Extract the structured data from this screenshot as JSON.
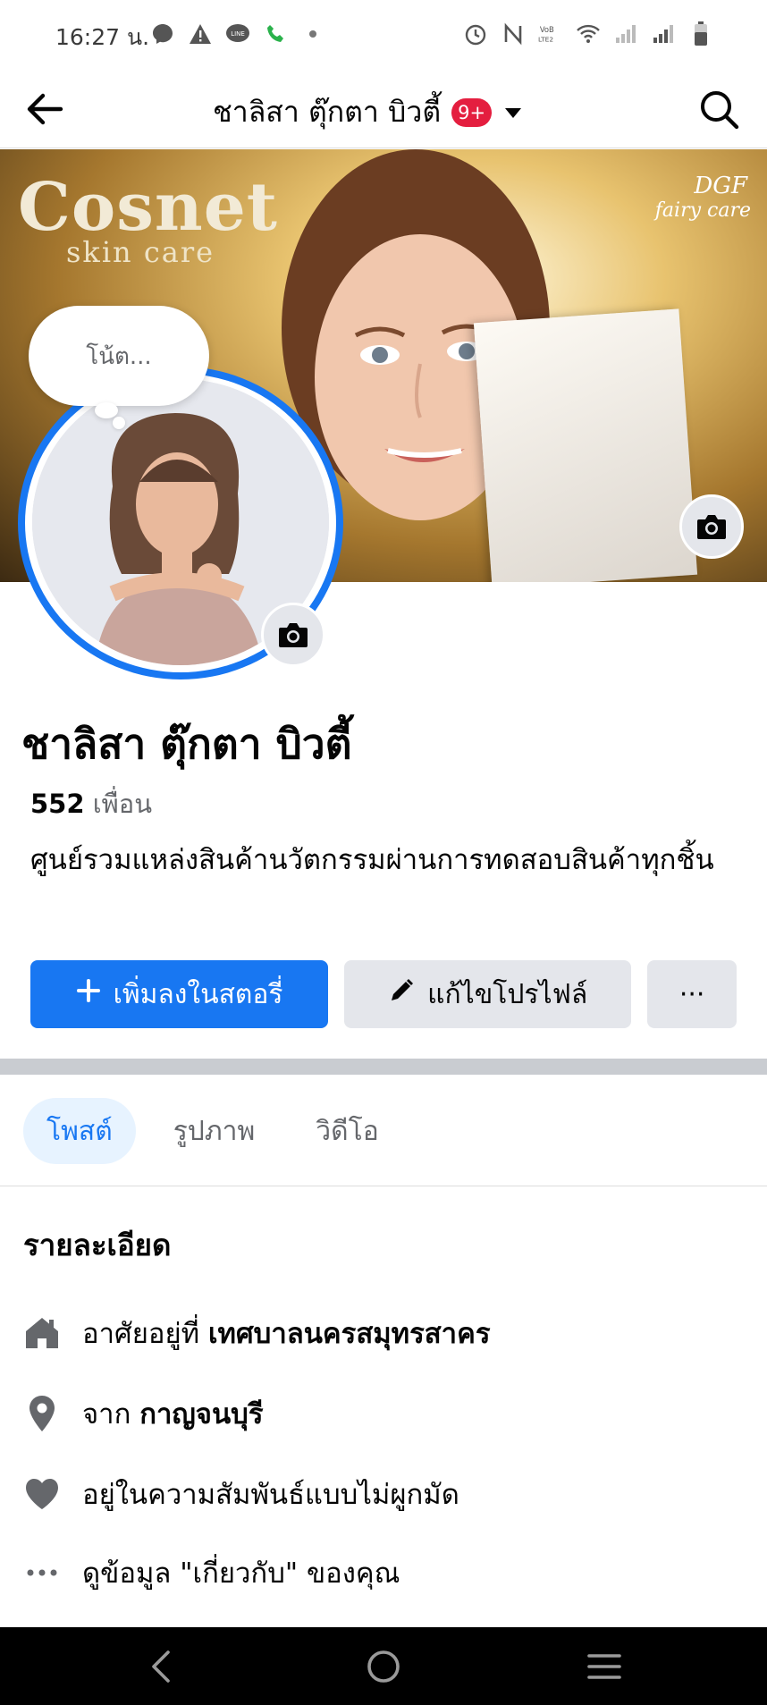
{
  "status_bar": {
    "time": "16:27 น.",
    "left_icons": [
      "messenger-icon",
      "warning-icon",
      "line-icon",
      "phone-icon",
      "dot-icon"
    ],
    "right_icons": [
      "alarm-icon",
      "nfc-icon",
      "volte-icon",
      "wifi-icon",
      "signal-1-icon",
      "signal-2-icon",
      "battery-icon"
    ]
  },
  "nav": {
    "title": "ชาลิสา ตุ๊กตา บิวตี้",
    "badge": "9+",
    "icons": {
      "back": "arrow-left-icon",
      "dropdown": "caret-down-icon",
      "search": "search-icon"
    }
  },
  "cover": {
    "brand": "Cosnet",
    "subtitle": "skin care",
    "logo_line1": "DGF",
    "logo_line2": "fairy care"
  },
  "profile": {
    "note_placeholder": "โน้ต...",
    "name": "ชาลิสา ตุ๊กตา บิวตี้",
    "friends_count": "552",
    "friends_label": "เพื่อน",
    "bio": "ศูนย์รวมแหล่งสินค้านวัตกรรมผ่านการทดสอบสินค้าทุกชิ้น"
  },
  "actions": {
    "add_story": "เพิ่มลงในสตอรี่",
    "edit_profile": "แก้ไขโปรไฟล์",
    "more": "···"
  },
  "tabs": [
    {
      "label": "โพสต์",
      "active": true
    },
    {
      "label": "รูปภาพ",
      "active": false
    },
    {
      "label": "วิดีโอ",
      "active": false
    }
  ],
  "details": {
    "title": "รายละเอียด",
    "lives_in_prefix": "อาศัยอยู่ที่",
    "lives_in_value": "เทศบาลนครสมุทรสาคร",
    "from_prefix": "จาก",
    "from_value": "กาญจนบุรี",
    "relationship": "อยู่ในความสัมพันธ์แบบไม่ผูกมัด",
    "about": "ดูข้อมูล \"เกี่ยวกับ\" ของคุณ"
  },
  "colors": {
    "accent": "#1877f2",
    "badge": "#e41e3f",
    "secondary_button": "#e4e6eb",
    "muted_text": "#65676b",
    "active_tab_bg": "#e7f3ff"
  }
}
